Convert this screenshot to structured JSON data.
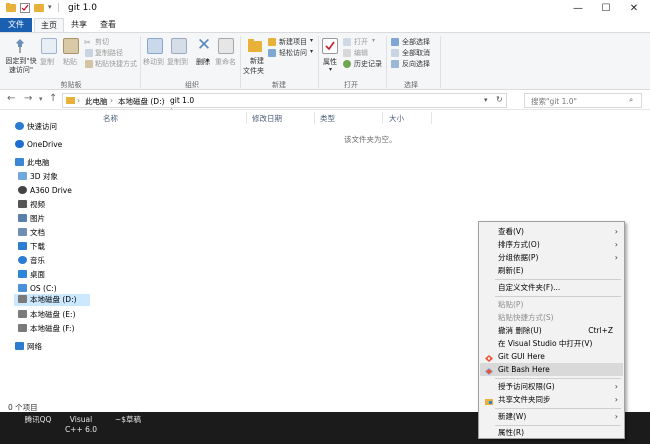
{
  "window": {
    "title": "git 1.0",
    "controls": [
      "minimize-icon",
      "maximize-icon",
      "close-icon"
    ]
  },
  "ribbon_tabs": [
    "文件",
    "主页",
    "共享",
    "查看"
  ],
  "ribbon": {
    "clipboard": {
      "pin": "固定到\"快速访问\"",
      "copy": "复制",
      "paste": "粘贴",
      "cut": "剪切",
      "copy_path": "复制路径",
      "paste_shortcut": "粘贴快捷方式",
      "group": "剪贴板"
    },
    "organize": {
      "move_to": "移动到",
      "copy_to": "复制到",
      "delete": "删除",
      "rename": "重命名",
      "group": "组织"
    },
    "new": {
      "new_folder_l1": "新建",
      "new_folder_l2": "文件夹",
      "new_item": "新建项目",
      "easy_access": "轻松访问",
      "group": "新建"
    },
    "open": {
      "properties": "属性",
      "open": "打开",
      "edit": "编辑",
      "history": "历史记录",
      "group": "打开"
    },
    "select": {
      "select_all": "全部选择",
      "select_none": "全部取消",
      "invert": "反向选择",
      "group": "选择"
    }
  },
  "address": {
    "crumbs": [
      "此电脑",
      "本地磁盘 (D:)",
      "git 1.0"
    ],
    "search_placeholder": "搜索\"git 1.0\""
  },
  "nav_pane": [
    {
      "label": "快速访问",
      "icon": "star-icon",
      "color": "#2b7cd3"
    },
    {
      "label": "OneDrive",
      "icon": "cloud-icon",
      "color": "#1e6fd0"
    },
    {
      "label": "此电脑",
      "icon": "computer-icon",
      "color": "#3a87d6"
    },
    {
      "label": "3D 对象",
      "icon": "cube-icon",
      "color": "#6ea8dc"
    },
    {
      "label": "A360 Drive",
      "icon": "a360-icon",
      "color": "#444444"
    },
    {
      "label": "视频",
      "icon": "video-icon",
      "color": "#555555"
    },
    {
      "label": "图片",
      "icon": "picture-icon",
      "color": "#5a7fa8"
    },
    {
      "label": "文档",
      "icon": "document-icon",
      "color": "#6d8fb3"
    },
    {
      "label": "下载",
      "icon": "download-icon",
      "color": "#2b7cd3"
    },
    {
      "label": "音乐",
      "icon": "music-icon",
      "color": "#2b7cd3"
    },
    {
      "label": "桌面",
      "icon": "desktop-icon",
      "color": "#2b88d8"
    },
    {
      "label": "OS (C:)",
      "icon": "drive-icon",
      "color": "#4a90d9"
    },
    {
      "label": "本地磁盘 (D:)",
      "icon": "drive-icon",
      "color": "#7a7a7a"
    },
    {
      "label": "本地磁盘 (E:)",
      "icon": "drive-icon",
      "color": "#7a7a7a"
    },
    {
      "label": "本地磁盘 (F:)",
      "icon": "drive-icon",
      "color": "#7a7a7a"
    },
    {
      "label": "网络",
      "icon": "network-icon",
      "color": "#2b7cd3"
    }
  ],
  "columns": [
    "名称",
    "修改日期",
    "类型",
    "大小"
  ],
  "empty_text": "该文件夹为空。",
  "status": "0 个项目",
  "taskbar": {
    "items": [
      {
        "label": "腾讯QQ"
      },
      {
        "label": "Visual C++ 6.0"
      },
      {
        "label": "~$草稿"
      }
    ]
  },
  "context_menu": [
    {
      "label": "查看(V)",
      "arrow": true
    },
    {
      "label": "排序方式(O)",
      "arrow": true
    },
    {
      "label": "分组依据(P)",
      "arrow": true
    },
    {
      "label": "刷新(E)"
    },
    {
      "label": "自定义文件夹(F)..."
    },
    {
      "label": "粘贴(P)",
      "disabled": true
    },
    {
      "label": "粘贴快捷方式(S)",
      "disabled": true
    },
    {
      "label": "撤消 删除(U)",
      "shortcut": "Ctrl+Z"
    },
    {
      "label": "在 Visual Studio 中打开(V)",
      "icon": "visual-studio-icon"
    },
    {
      "label": "Git GUI Here",
      "icon": "git-icon"
    },
    {
      "label": "Git Bash Here",
      "icon": "git-icon",
      "highlighted": true
    },
    {
      "label": "授予访问权限(G)",
      "arrow": true
    },
    {
      "label": "共享文件夹同步",
      "icon": "sync-icon"
    },
    {
      "label": "新建(W)",
      "arrow": true
    },
    {
      "label": "属性(R)"
    }
  ]
}
